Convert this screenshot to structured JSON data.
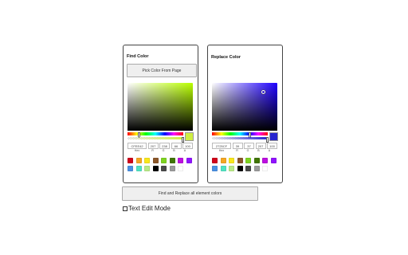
{
  "find": {
    "title": "Find Color",
    "pick_button": "Pick Color From Page",
    "base_hue": "#B9FF00",
    "picked_color": "#CFEE42",
    "hex": "CFEE42",
    "r": "207",
    "g": "238",
    "b": "66",
    "a": "100",
    "swatches": [
      "#D0021B",
      "#F5A623",
      "#F8E71C",
      "#8B572A",
      "#7ED321",
      "#417505",
      "#BD10E0",
      "#9013FE",
      "#4A90E2",
      "#50E3C2",
      "#B8E986",
      "#000000",
      "#4A4A4A",
      "#9B9B9B",
      "#FFFFFF"
    ]
  },
  "replace": {
    "title": "Replace Color",
    "base_hue": "#1E00FF",
    "picked_color": "#2725CF",
    "hex": "2725CF",
    "r": "39",
    "g": "37",
    "b": "207",
    "a": "100",
    "swatches": [
      "#D0021B",
      "#F5A623",
      "#F8E71C",
      "#8B572A",
      "#7ED321",
      "#417505",
      "#BD10E0",
      "#9013FE",
      "#4A90E2",
      "#50E3C2",
      "#B8E986",
      "#000000",
      "#4A4A4A",
      "#9B9B9B",
      "#FFFFFF"
    ]
  },
  "labels": {
    "hex": "Hex",
    "r": "R",
    "g": "G",
    "b": "B",
    "a": "A"
  },
  "actions": {
    "find_replace_button": "Find and Replace all element colors",
    "text_edit_label": "Text Edit Mode",
    "text_edit_checked": false
  }
}
